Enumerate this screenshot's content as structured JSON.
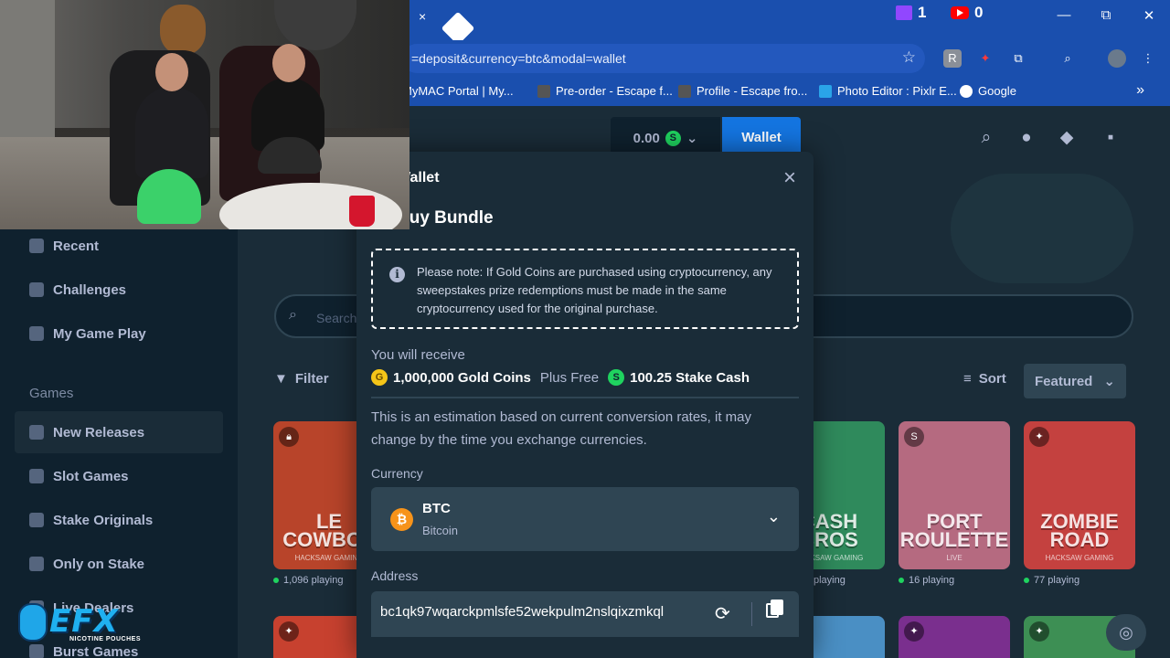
{
  "browser": {
    "tab_close": "×",
    "stream": {
      "twitch_count": "1",
      "youtube_count": "0"
    },
    "window_controls": {
      "minimize": "—",
      "maximize": "⧉",
      "close": "✕"
    },
    "url": "=deposit&currency=btc&modal=wallet",
    "bookmarks": [
      {
        "label": "MyMAC Portal | My...",
        "icon": "portal-icon"
      },
      {
        "label": "Pre-order - Escape f...",
        "icon": "game-icon"
      },
      {
        "label": "Profile - Escape fro...",
        "icon": "game-icon"
      },
      {
        "label": "Photo Editor : Pixlr E...",
        "icon": "pixlr-icon"
      },
      {
        "label": "Google",
        "icon": "google-icon"
      }
    ],
    "more": "»"
  },
  "header": {
    "balance": "0.00",
    "balance_coin": "S",
    "wallet_label": "Wallet"
  },
  "sidebar": {
    "items": [
      {
        "label": "Recent"
      },
      {
        "label": "Challenges"
      },
      {
        "label": "My Game Play"
      }
    ],
    "games_heading": "Games",
    "game_items": [
      {
        "label": "New Releases",
        "active": true
      },
      {
        "label": "Slot Games"
      },
      {
        "label": "Stake Originals"
      },
      {
        "label": "Only on Stake"
      },
      {
        "label": "Live Dealers"
      },
      {
        "label": "Burst Games"
      }
    ]
  },
  "main": {
    "search_placeholder": "Search",
    "filter_label": "Filter",
    "sort_label": "Sort",
    "sort_value": "Featured",
    "games": [
      {
        "title": "LE COWBOY",
        "studio": "HACKSAW GAMING",
        "playing": "1,096 playing",
        "color": "#b8442a"
      },
      {
        "title": "CASH BROS",
        "studio": "HACKSAW GAMING",
        "playing": "playing",
        "color": "#2f8a5c"
      },
      {
        "title": "PORT ROULETTE",
        "studio": "LIVE",
        "playing": "16 playing",
        "color": "#b56a80"
      },
      {
        "title": "ZOMBIE ROAD",
        "studio": "HACKSAW GAMING",
        "playing": "77 playing",
        "color": "#c4413f"
      }
    ]
  },
  "modal": {
    "title": "Wallet",
    "subtitle": "Buy Bundle",
    "note": "Please note: If Gold Coins are purchased using cryptocurrency, any sweepstakes prize redemptions must be made in the same cryptocurrency used for the original purchase.",
    "receive_label": "You will receive",
    "gold_coins": "1,000,000 Gold Coins",
    "plus_free": "Plus Free",
    "stake_cash": "100.25 Stake Cash",
    "estimate": "This is an estimation based on current conversion rates, it may change by the time you exchange currencies.",
    "currency_label": "Currency",
    "currency_code": "BTC",
    "currency_name": "Bitcoin",
    "address_label": "Address",
    "address_value": "bc1qk97wqarckpmlsfe52wekpulm2nslqixzmkql"
  },
  "overlay": {
    "logo_text": "EFX",
    "logo_sub": "NICOTINE POUCHES"
  },
  "colors": {
    "bg_dark": "#0f212e",
    "bg_panel": "#1a2c38",
    "accent_blue": "#1475e1",
    "stake_green": "#1fd35f",
    "gold": "#f5c518",
    "btc_orange": "#f7931a",
    "browser_blue": "#1a4fae"
  }
}
